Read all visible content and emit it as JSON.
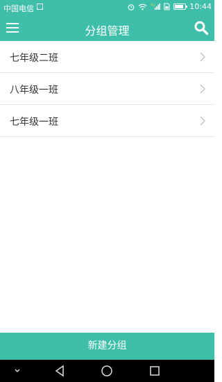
{
  "status_bar": {
    "carrier": "中国电信",
    "time": "10:44",
    "network": "4G",
    "battery_level": 0.85
  },
  "app_bar": {
    "title": "分组管理"
  },
  "groups": [
    {
      "label": "七年级二班"
    },
    {
      "label": "八年级一班"
    },
    {
      "label": "七年级一班"
    }
  ],
  "bottom_button": {
    "label": "新建分组"
  },
  "icons": {
    "menu": "menu-icon",
    "search": "search-icon",
    "chevron": "chevron-right-icon",
    "back": "back-icon",
    "home": "home-icon",
    "recents": "recents-icon",
    "collapse": "chevron-down-icon"
  },
  "colors": {
    "accent": "#3fbfa9",
    "nav_bar": "#000000"
  }
}
